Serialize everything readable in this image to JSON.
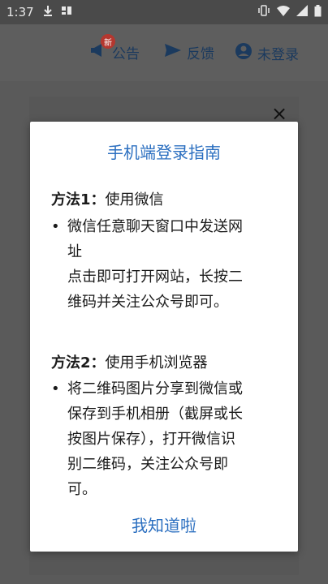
{
  "status_bar": {
    "time": "1:37",
    "icons": [
      "download-icon",
      "app-notification-icon",
      "vibrate-icon",
      "wifi-icon",
      "signal-icon",
      "battery-icon"
    ]
  },
  "header": {
    "announcement_label": "公告",
    "announcement_badge": "新",
    "feedback_label": "反馈",
    "login_label": "未登录"
  },
  "dialog": {
    "title": "手机端登录指南",
    "method1_label": "方法1",
    "method1_colon": "：",
    "method1_name": "使用微信",
    "method1_bullet_line1": "微信任意聊天窗口中发送网",
    "method1_bullet_line2": "址",
    "method1_bullet_line3": "点击即可打开网站，长按二",
    "method1_bullet_line4": "维码并关注公众号即可。",
    "method2_label": "方法2",
    "method2_colon": "：",
    "method2_name": "使用手机浏览器",
    "method2_bullet_line1": "将二维码图片分享到微信或",
    "method2_bullet_line2": "保存到手机相册（截屏或长",
    "method2_bullet_line3": "按图片保存），打开微信识",
    "method2_bullet_line4": "别二维码，关注公众号即",
    "method2_bullet_line5": "可。",
    "confirm_label": "我知道啦"
  },
  "underlay": {
    "close_glyph": "×"
  },
  "colors": {
    "accent": "#2b6fc0",
    "badge": "#b5372f",
    "overlay": "#5a5a5a"
  }
}
